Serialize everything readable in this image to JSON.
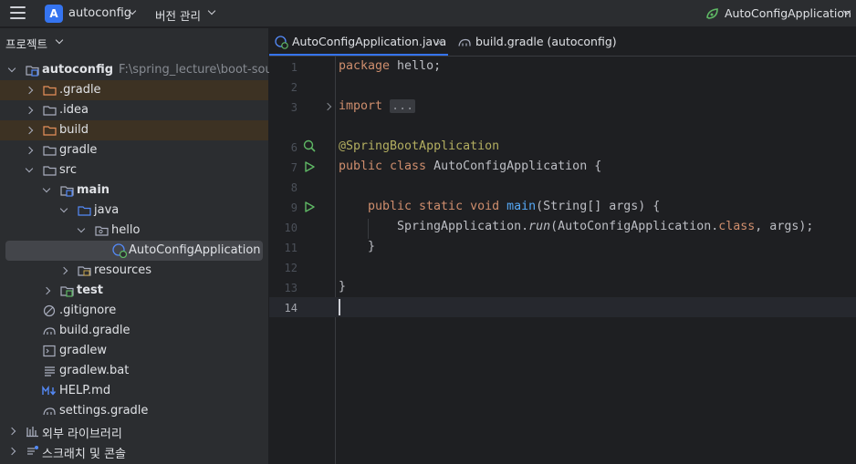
{
  "titlebar": {
    "project_badge": "A",
    "project_name": "autoconfig",
    "vcs_label": "버전 관리",
    "run_config": "AutoConfigApplication"
  },
  "project_panel": {
    "header": "프로젝트",
    "tree": [
      {
        "label": "autoconfig",
        "path": "F:\\spring_lecture\\boot-sour",
        "icon": "module-folder-icon",
        "expanded": true
      },
      {
        "label": ".gradle",
        "icon": "folder-excluded-icon",
        "expanded": false
      },
      {
        "label": ".idea",
        "icon": "folder-icon",
        "expanded": false
      },
      {
        "label": "build",
        "icon": "folder-excluded-icon",
        "expanded": false
      },
      {
        "label": "gradle",
        "icon": "folder-icon",
        "expanded": false
      },
      {
        "label": "src",
        "icon": "folder-icon",
        "expanded": true
      },
      {
        "label": "main",
        "icon": "source-root-folder-icon",
        "expanded": true
      },
      {
        "label": "java",
        "icon": "java-folder-icon",
        "expanded": true
      },
      {
        "label": "hello",
        "icon": "package-icon",
        "expanded": true
      },
      {
        "label": "AutoConfigApplication",
        "icon": "spring-class-icon",
        "selected": true
      },
      {
        "label": "resources",
        "icon": "resources-folder-icon",
        "expanded": false
      },
      {
        "label": "test",
        "icon": "test-folder-icon",
        "expanded": false
      },
      {
        "label": ".gitignore",
        "icon": "ignore-file-icon"
      },
      {
        "label": "build.gradle",
        "icon": "gradle-icon"
      },
      {
        "label": "gradlew",
        "icon": "terminal-file-icon"
      },
      {
        "label": "gradlew.bat",
        "icon": "text-file-icon"
      },
      {
        "label": "HELP.md",
        "icon": "markdown-icon"
      },
      {
        "label": "settings.gradle",
        "icon": "gradle-icon"
      },
      {
        "label": "외부 라이브러리",
        "icon": "library-icon",
        "expanded": false
      },
      {
        "label": "스크래치 및 콘솔",
        "icon": "scratch-icon",
        "expanded": false
      }
    ]
  },
  "editor": {
    "tabs": [
      {
        "label": "AutoConfigApplication.java",
        "active": true,
        "close": "×"
      },
      {
        "label": "build.gradle (autoconfig)",
        "active": false
      }
    ],
    "line_numbers": [
      "1",
      "2",
      "3",
      "6",
      "7",
      "8",
      "9",
      "10",
      "11",
      "12",
      "13",
      "14"
    ],
    "current_line": "14",
    "code": {
      "l1_kw": "package",
      "l1_rest": " hello;",
      "l3_kw": "import",
      "l3_fold": "...",
      "l6_ann": "@SpringBootApplication",
      "l7_kw": "public class",
      "l7_rest": " AutoConfigApplication {",
      "l9_kw": "public static void",
      "l9_fn": "main",
      "l9_rest": "(String[] args) {",
      "l10_a": "SpringApplication.",
      "l10_run": "run",
      "l10_b": "(AutoConfigApplication.",
      "l10_kw": "class",
      "l10_c": ", args);",
      "l11": "}",
      "l13": "}"
    }
  },
  "colors": {
    "accent": "#3574f0",
    "run_green": "#5fb865",
    "keyword": "#cf8e6d",
    "annotation": "#b3ae60",
    "function": "#56a8f5"
  }
}
